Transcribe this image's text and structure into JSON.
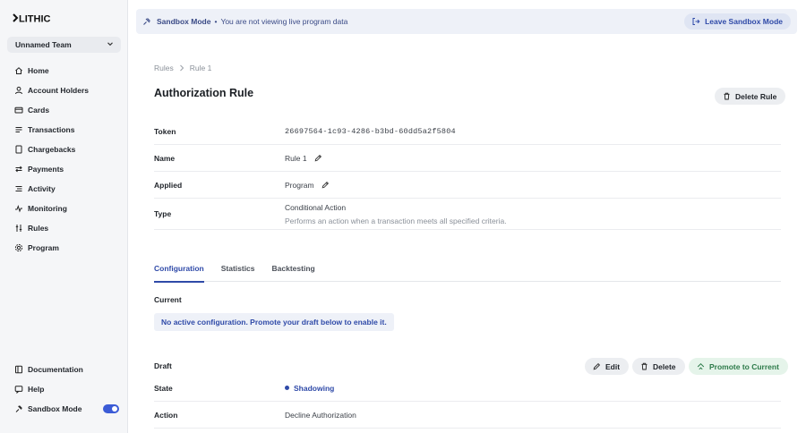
{
  "brand": {
    "logo_text": "LITHIC"
  },
  "sidebar": {
    "team": "Unnamed Team",
    "items": [
      {
        "label": "Home",
        "icon": "home-icon"
      },
      {
        "label": "Account Holders",
        "icon": "user-icon"
      },
      {
        "label": "Cards",
        "icon": "card-icon"
      },
      {
        "label": "Transactions",
        "icon": "list-icon"
      },
      {
        "label": "Chargebacks",
        "icon": "document-icon"
      },
      {
        "label": "Payments",
        "icon": "transfer-icon"
      },
      {
        "label": "Activity",
        "icon": "activity-icon"
      },
      {
        "label": "Monitoring",
        "icon": "monitoring-icon"
      },
      {
        "label": "Rules",
        "icon": "rules-icon"
      },
      {
        "label": "Program",
        "icon": "gear-icon"
      }
    ],
    "bottom": [
      {
        "label": "Documentation",
        "icon": "book-icon"
      },
      {
        "label": "Help",
        "icon": "help-icon"
      },
      {
        "label": "Sandbox Mode",
        "icon": "sandbox-icon",
        "toggle_on": true
      }
    ]
  },
  "banner": {
    "mode": "Sandbox Mode",
    "separator": "•",
    "message": "You are not viewing live program data",
    "leave_label": "Leave Sandbox Mode"
  },
  "breadcrumb": {
    "parent": "Rules",
    "current": "Rule 1"
  },
  "page": {
    "title": "Authorization Rule",
    "delete_rule_label": "Delete Rule"
  },
  "details": {
    "token_label": "Token",
    "token_value": "26697564-1c93-4286-b3bd-60dd5a2f5804",
    "name_label": "Name",
    "name_value": "Rule 1",
    "applied_label": "Applied",
    "applied_value": "Program",
    "type_label": "Type",
    "type_value": "Conditional Action",
    "type_description": "Performs an action when a transaction meets all specified criteria."
  },
  "tabs": [
    {
      "label": "Configuration",
      "active": true
    },
    {
      "label": "Statistics",
      "active": false
    },
    {
      "label": "Backtesting",
      "active": false
    }
  ],
  "current": {
    "label": "Current",
    "notice": "No active configuration. Promote your draft below to enable it."
  },
  "draft": {
    "label": "Draft",
    "edit_label": "Edit",
    "delete_label": "Delete",
    "promote_label": "Promote to Current",
    "state_label": "State",
    "state_value": "Shadowing",
    "action_label": "Action",
    "action_value": "Decline Authorization"
  },
  "colors": {
    "accent": "#2f4aa8",
    "promote": "#2c7a49",
    "sidebar_bg": "#f5f6f8"
  }
}
